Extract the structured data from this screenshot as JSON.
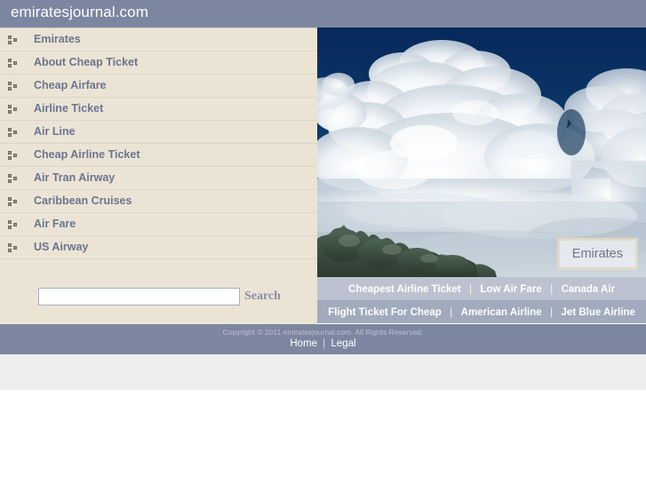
{
  "header": {
    "title": "emiratesjournal.com",
    "background_color": "#7d86a0",
    "title_color": "#ffffff"
  },
  "sidebar": {
    "background_color": "#ebe4d5",
    "divider_color": "#ded6c4",
    "link_color": "#6b7490",
    "items": [
      {
        "label": "Emirates",
        "icon": "squares-bullet-icon"
      },
      {
        "label": "About Cheap Ticket",
        "icon": "squares-bullet-icon"
      },
      {
        "label": "Cheap Airfare",
        "icon": "squares-bullet-icon"
      },
      {
        "label": "Airline Ticket",
        "icon": "squares-bullet-icon"
      },
      {
        "label": "Air Line",
        "icon": "squares-bullet-icon"
      },
      {
        "label": "Cheap Airline Ticket",
        "icon": "squares-bullet-icon"
      },
      {
        "label": "Air Tran Airway",
        "icon": "squares-bullet-icon"
      },
      {
        "label": "Caribbean Cruises",
        "icon": "squares-bullet-icon"
      },
      {
        "label": "Air Fare",
        "icon": "squares-bullet-icon"
      },
      {
        "label": "US Airway",
        "icon": "squares-bullet-icon"
      }
    ]
  },
  "search": {
    "value": "",
    "placeholder": "",
    "button_label": "Search"
  },
  "hero": {
    "image_description": "cumulus-clouds-over-treeline-photo",
    "badge_label": "Emirates",
    "sky_color": "#0a2a55",
    "cloud_color": "#ffffff"
  },
  "link_rows": [
    {
      "background_color": "#bcc2d0",
      "separator": "|",
      "links": [
        "Cheapest Airline Ticket",
        "Low Air Fare",
        "Canada Air"
      ]
    },
    {
      "background_color": "#a2aabd",
      "separator": "|",
      "links": [
        "Flight Ticket For Cheap",
        "American Airline",
        "Jet Blue Airline"
      ]
    }
  ],
  "footer": {
    "background_color": "#7d86a0",
    "copyright": "Copyright © 2011 emiratesjournal.com. All Rights Reserved.",
    "separator": "|",
    "links": [
      "Home",
      "Legal"
    ]
  }
}
